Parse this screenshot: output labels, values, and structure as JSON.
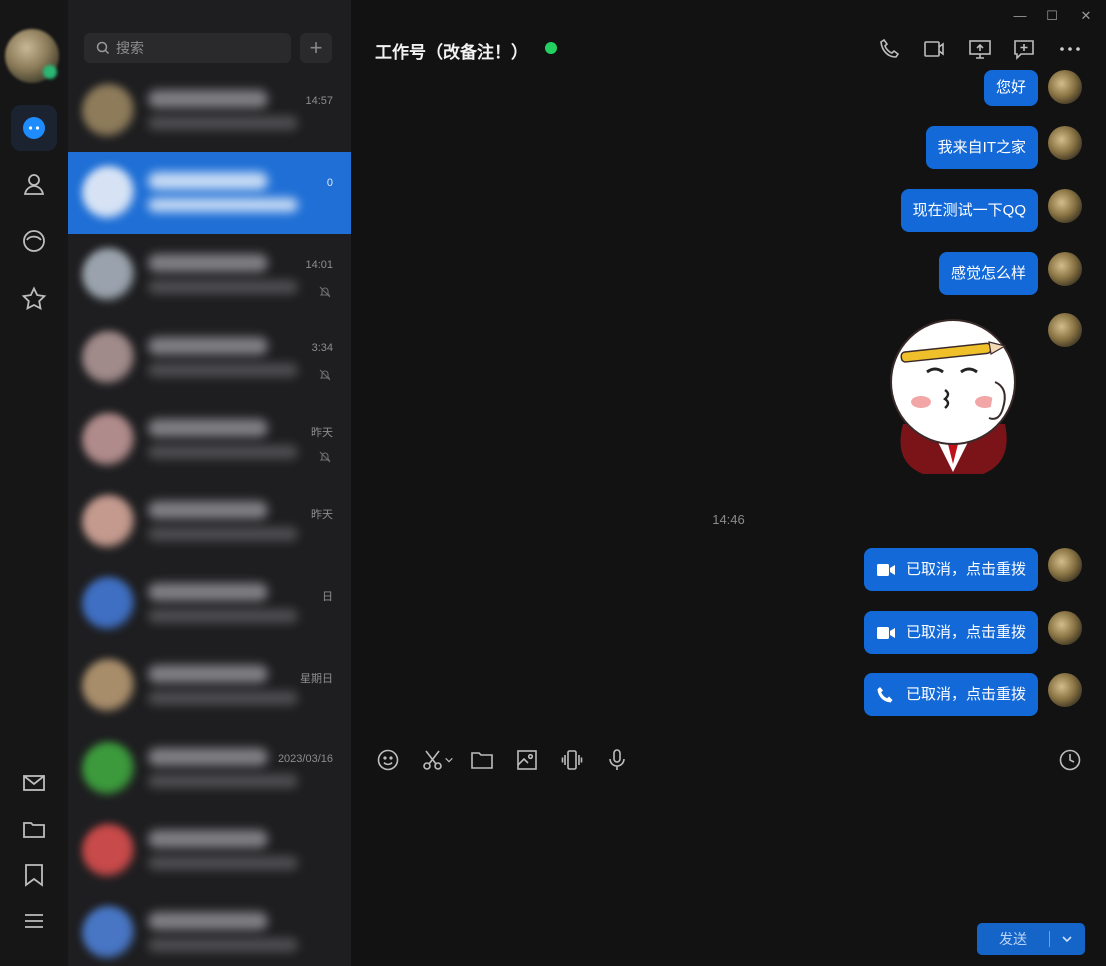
{
  "search": {
    "placeholder": "搜索"
  },
  "conversations": [
    {
      "time": "14:57",
      "muted": false,
      "avatar_color": "#8d7b5a",
      "selected": false
    },
    {
      "time": "0",
      "muted": false,
      "avatar_color": "#d7e3f5",
      "selected": true
    },
    {
      "time": "14:01",
      "muted": true,
      "avatar_color": "#9aa3ad",
      "selected": false
    },
    {
      "time": "3:34",
      "muted": true,
      "avatar_color": "#a08a8a",
      "selected": false
    },
    {
      "time": "昨天",
      "muted": true,
      "avatar_color": "#b08b8b",
      "selected": false
    },
    {
      "time": "昨天",
      "muted": false,
      "avatar_color": "#c49a8e",
      "selected": false
    },
    {
      "time": "日",
      "muted": false,
      "avatar_color": "#3f6fc2",
      "selected": false
    },
    {
      "time": "星期日",
      "muted": false,
      "avatar_color": "#a88d6a",
      "selected": false
    },
    {
      "time": "2023/03/16",
      "muted": false,
      "avatar_color": "#3c9a3c",
      "selected": false
    },
    {
      "time": "",
      "muted": false,
      "avatar_color": "#c84a4a",
      "selected": false
    },
    {
      "time": "",
      "muted": false,
      "avatar_color": "#4876c4",
      "selected": false
    }
  ],
  "chat": {
    "title": "工作号（改备注！）",
    "online": true,
    "messages": [
      {
        "text": "您好"
      },
      {
        "text": "我来自IT之家"
      },
      {
        "text": "现在测试一下QQ"
      },
      {
        "text": "感觉怎么样"
      }
    ],
    "time_separator": "14:46",
    "calls": [
      {
        "icon": "video-call-icon",
        "text": "已取消，点击重拨"
      },
      {
        "icon": "video-call-icon",
        "text": "已取消，点击重拨"
      },
      {
        "icon": "phone-icon",
        "text": "已取消，点击重拨"
      }
    ],
    "send_label": "发送"
  },
  "colors": {
    "accent": "#1469d8",
    "online": "#22d160",
    "selected_row": "#1f6fd6"
  }
}
